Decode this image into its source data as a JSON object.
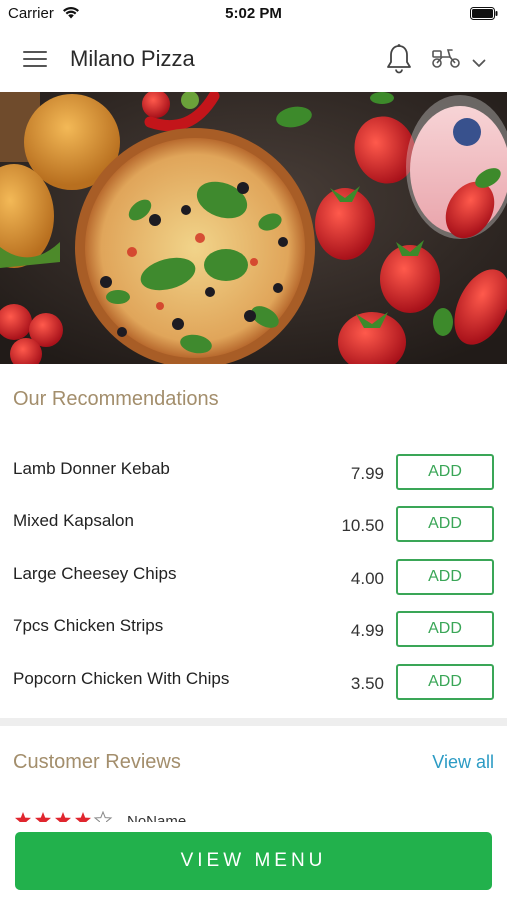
{
  "status_bar": {
    "carrier": "Carrier",
    "time": "5:02 PM",
    "icons": [
      "wifi-icon",
      "battery-icon"
    ]
  },
  "header": {
    "title": "Milano Pizza",
    "icons": [
      "menu-icon",
      "bell-icon",
      "scooter-icon",
      "chevron-down-icon"
    ]
  },
  "hero": {
    "description_icons": [
      "pizza",
      "burgers",
      "strawberries",
      "smoothie",
      "tomatoes",
      "chili"
    ]
  },
  "recommendations": {
    "title": "Our Recommendations",
    "items": [
      {
        "name": "Lamb Donner Kebab",
        "price": "7.99",
        "action": "ADD"
      },
      {
        "name": "Mixed Kapsalon",
        "price": "10.50",
        "action": "ADD"
      },
      {
        "name": "Large Cheesey Chips",
        "price": "4.00",
        "action": "ADD"
      },
      {
        "name": "7pcs Chicken Strips",
        "price": "4.99",
        "action": "ADD"
      },
      {
        "name": "Popcorn Chicken With Chips",
        "price": "3.50",
        "action": "ADD"
      }
    ]
  },
  "reviews": {
    "title": "Customer Reviews",
    "view_all": "View all",
    "items": [
      {
        "rating": 4,
        "max_rating": 5,
        "name": "NoName"
      }
    ]
  },
  "cta": {
    "label": "VIEW MENU"
  },
  "colors": {
    "accent_green": "#22b14c",
    "add_green": "#3aa657",
    "section_title": "#a38e6c",
    "link_blue": "#2b9bc4",
    "star_red": "#e0262e"
  }
}
